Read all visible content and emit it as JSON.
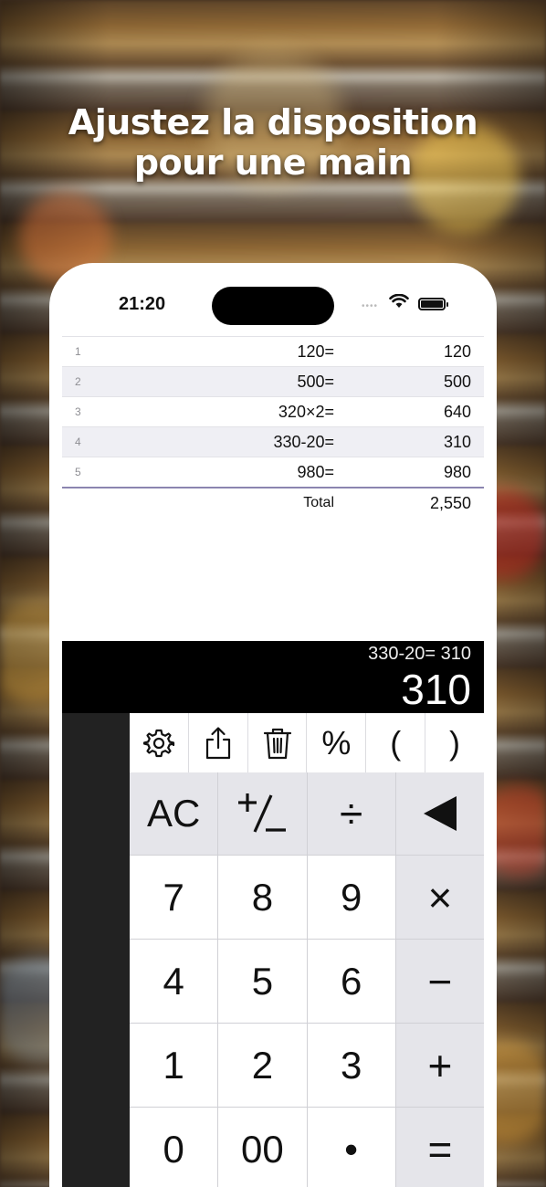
{
  "headline": {
    "line1": "Ajustez la disposition",
    "line2": "pour une main"
  },
  "status": {
    "time": "21:20"
  },
  "tape": {
    "rows": [
      {
        "n": "1",
        "expr": "120=",
        "result": "120"
      },
      {
        "n": "2",
        "expr": "500=",
        "result": "500"
      },
      {
        "n": "3",
        "expr": "320×2=",
        "result": "640"
      },
      {
        "n": "4",
        "expr": "330-20=",
        "result": "310"
      },
      {
        "n": "5",
        "expr": "980=",
        "result": "980"
      }
    ],
    "total_label": "Total",
    "total_value": "2,550"
  },
  "display": {
    "expression": "330-20= 310",
    "value": "310"
  },
  "toolbar": {
    "settings_icon": "gear-icon",
    "share_icon": "share-icon",
    "trash_icon": "trash-icon",
    "percent": "%",
    "open_paren": "(",
    "close_paren": ")"
  },
  "keys": {
    "ac": "AC",
    "plus_minus": "+/−",
    "divide": "÷",
    "backspace": "◀",
    "k7": "7",
    "k8": "8",
    "k9": "9",
    "multiply": "×",
    "k4": "4",
    "k5": "5",
    "k6": "6",
    "minus": "−",
    "k1": "1",
    "k2": "2",
    "k3": "3",
    "plus": "+",
    "k0": "0",
    "k00": "00",
    "dot": "•",
    "equals": "="
  }
}
